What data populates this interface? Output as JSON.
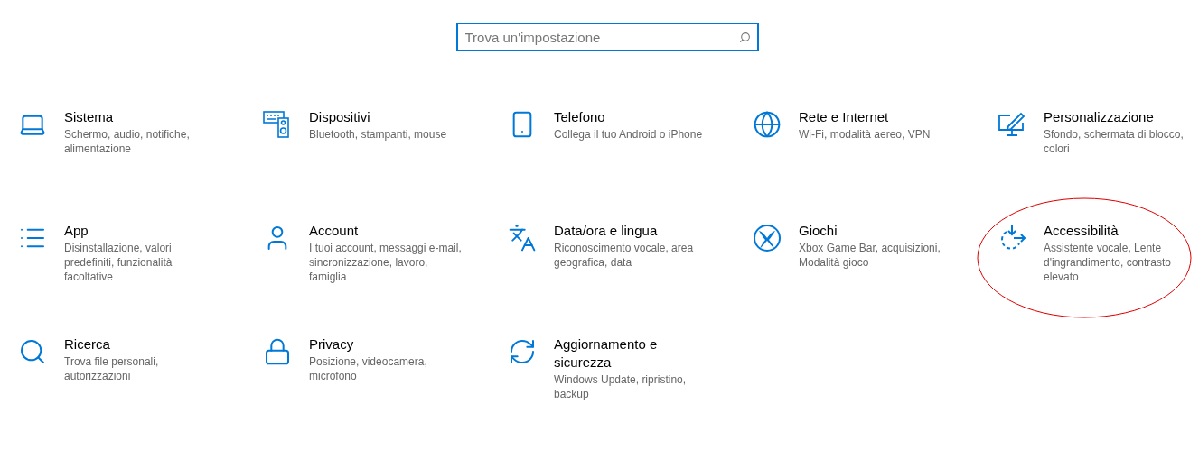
{
  "search": {
    "placeholder": "Trova un'impostazione"
  },
  "categories": [
    {
      "title": "Sistema",
      "description": "Schermo, audio, notifiche, alimentazione",
      "circled": false
    },
    {
      "title": "Dispositivi",
      "description": "Bluetooth, stampanti, mouse",
      "circled": false
    },
    {
      "title": "Telefono",
      "description": "Collega il tuo Android o iPhone",
      "circled": false
    },
    {
      "title": "Rete e Internet",
      "description": "Wi-Fi, modalità aereo, VPN",
      "circled": false
    },
    {
      "title": "Personalizzazione",
      "description": "Sfondo, schermata di blocco, colori",
      "circled": false
    },
    {
      "title": "App",
      "description": "Disinstallazione, valori predefiniti, funzionalità facoltative",
      "circled": false
    },
    {
      "title": "Account",
      "description": "I tuoi account, messaggi e-mail, sincronizzazione, lavoro, famiglia",
      "circled": false
    },
    {
      "title": "Data/ora e lingua",
      "description": "Riconoscimento vocale, area geografica, data",
      "circled": false
    },
    {
      "title": "Giochi",
      "description": "Xbox Game Bar, acquisizioni, Modalità gioco",
      "circled": false
    },
    {
      "title": "Accessibilità",
      "description": "Assistente vocale, Lente d'ingrandimento, contrasto elevato",
      "circled": true
    },
    {
      "title": "Ricerca",
      "description": "Trova file personali, autorizzazioni",
      "circled": false
    },
    {
      "title": "Privacy",
      "description": "Posizione, videocamera, microfono",
      "circled": false
    },
    {
      "title": "Aggiornamento e sicurezza",
      "description": "Windows Update, ripristino, backup",
      "circled": false
    }
  ]
}
